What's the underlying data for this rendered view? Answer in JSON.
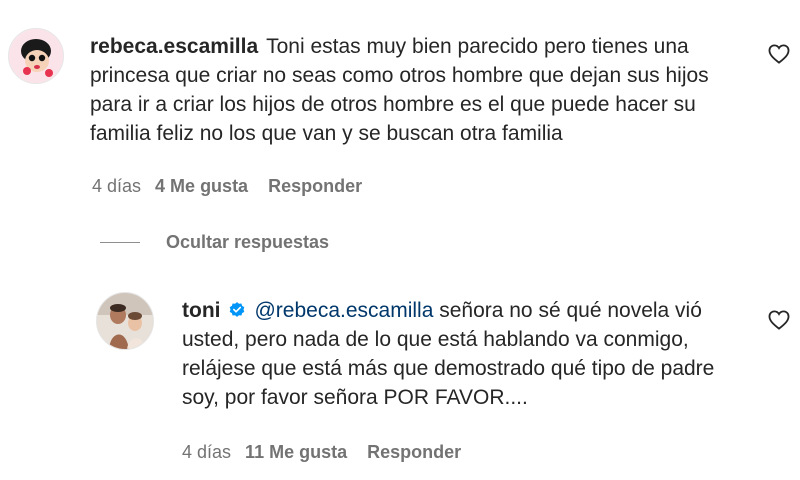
{
  "comments": [
    {
      "username": "rebeca.escamilla",
      "text": "Toni estas muy bien parecido pero tienes una princesa que criar no seas como otros hombre que dejan sus hijos para ir a criar los hijos de otros hombre es el que puede hacer su familia feliz no los que van y se buscan otra familia",
      "time": "4 días",
      "likes": "4 Me gusta",
      "reply_label": "Responder",
      "avatar_icon": "cartoon-avatar-icon"
    }
  ],
  "hide_replies_label": "Ocultar respuestas",
  "reply": {
    "username": "toni",
    "verified_icon": "verified-badge-icon",
    "mention": "@rebeca.escamilla",
    "text": " señora no sé qué novela vió usted, pero nada de lo que está hablando va conmigo, relájese que está más que demostrado qué tipo de padre soy, por favor señora POR FAVOR....",
    "time": "4 días",
    "likes": "11 Me gusta",
    "reply_label": "Responder",
    "avatar_icon": "photo-avatar-icon"
  },
  "colors": {
    "text": "#262626",
    "secondary": "#737373",
    "mention": "#00376b",
    "verified": "#0095f6"
  }
}
